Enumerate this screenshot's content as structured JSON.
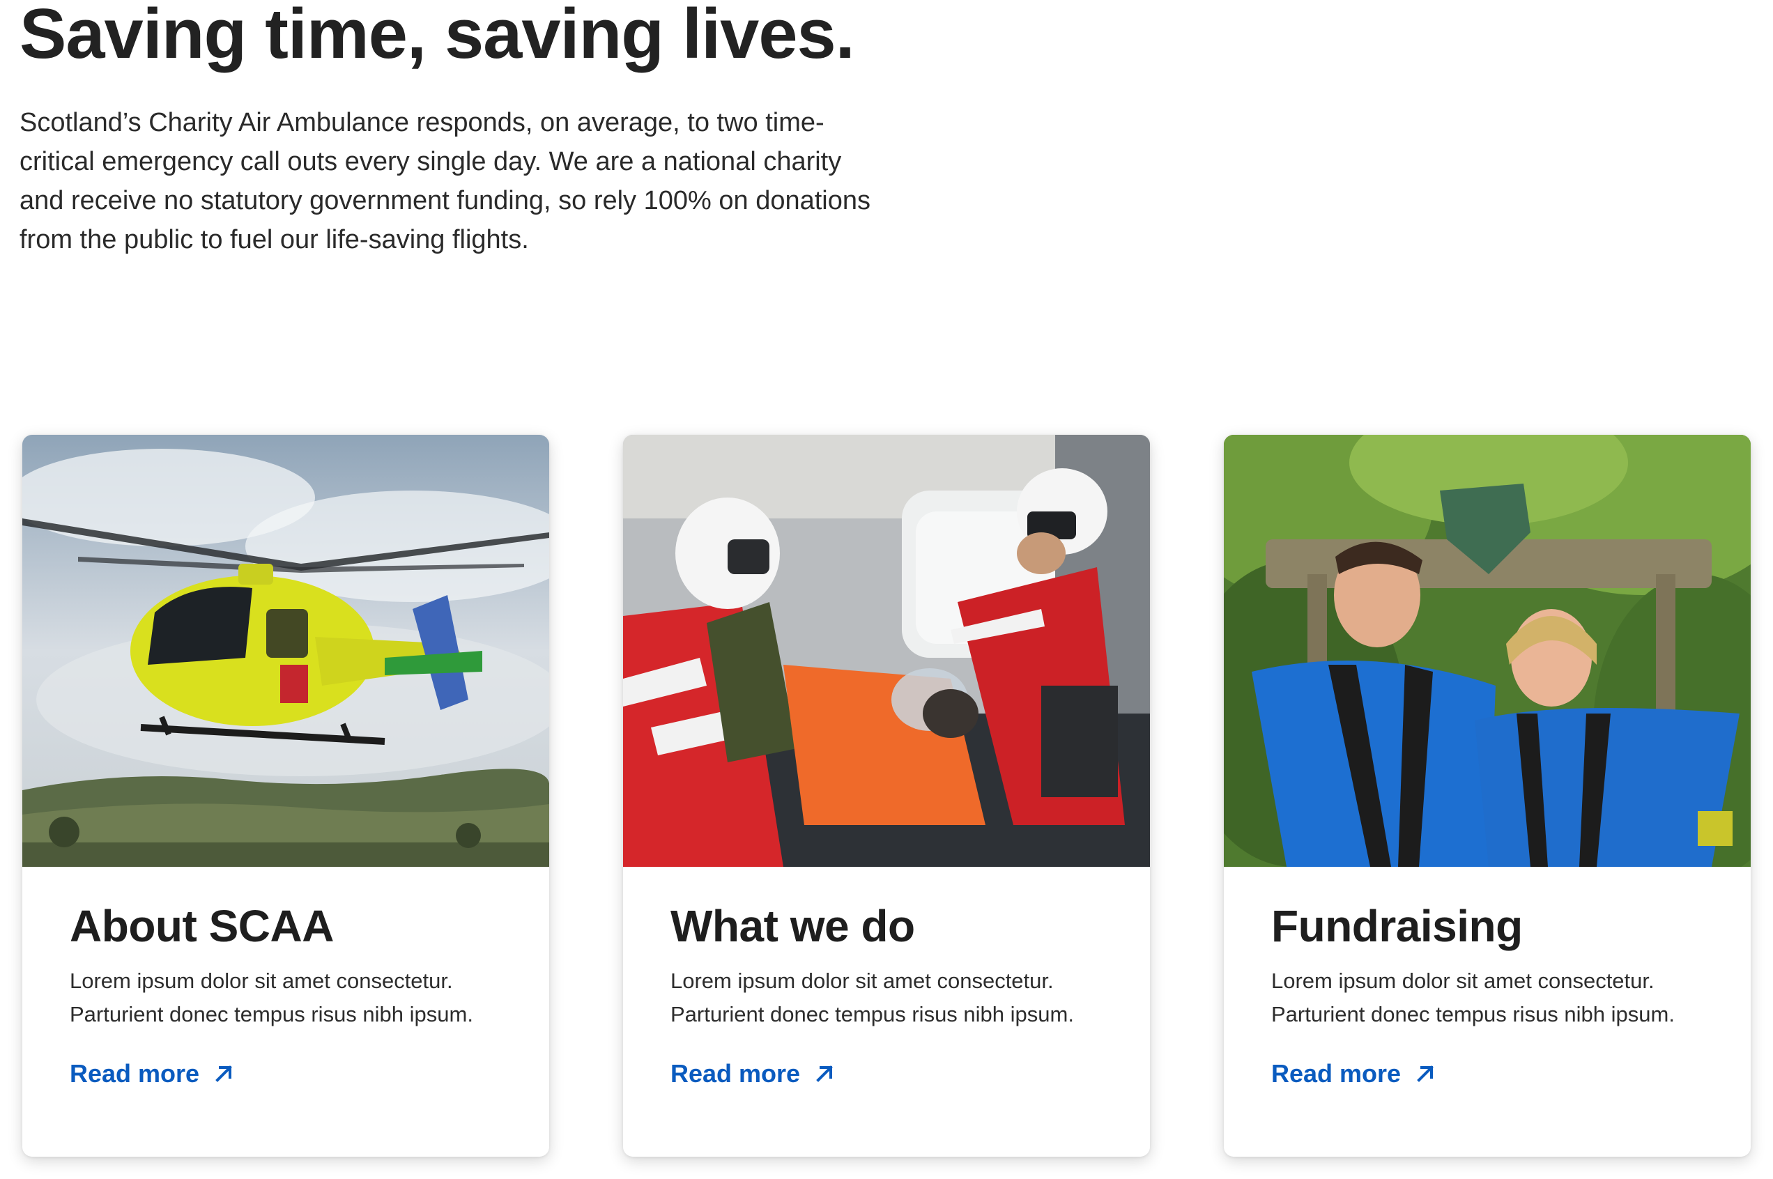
{
  "hero": {
    "title": "Saving time, saving lives.",
    "text": "Scotland’s Charity Air Ambulance responds, on average, to two time-critical emergency call outs every single day. We are a national charity and receive no statutory government funding, so rely 100% on donations from the public to fuel our life-saving flights."
  },
  "cards": [
    {
      "title": "About SCAA",
      "description": "Lorem ipsum dolor sit amet consectetur. Parturient donec tempus risus nibh ipsum.",
      "link_label": "Read more",
      "image": "helicopter-photo"
    },
    {
      "title": "What we do",
      "description": "Lorem ipsum dolor sit amet consectetur. Parturient donec tempus risus nibh ipsum.",
      "link_label": "Read more",
      "image": "paramedics-photo"
    },
    {
      "title": "Fundraising",
      "description": "Lorem ipsum dolor sit amet consectetur. Parturient donec tempus risus nibh ipsum.",
      "link_label": "Read more",
      "image": "fundraisers-photo"
    }
  ],
  "colors": {
    "link": "#0a5bbf",
    "heading": "#222222"
  },
  "icons": {
    "read_more": "arrow-up-right-icon"
  }
}
